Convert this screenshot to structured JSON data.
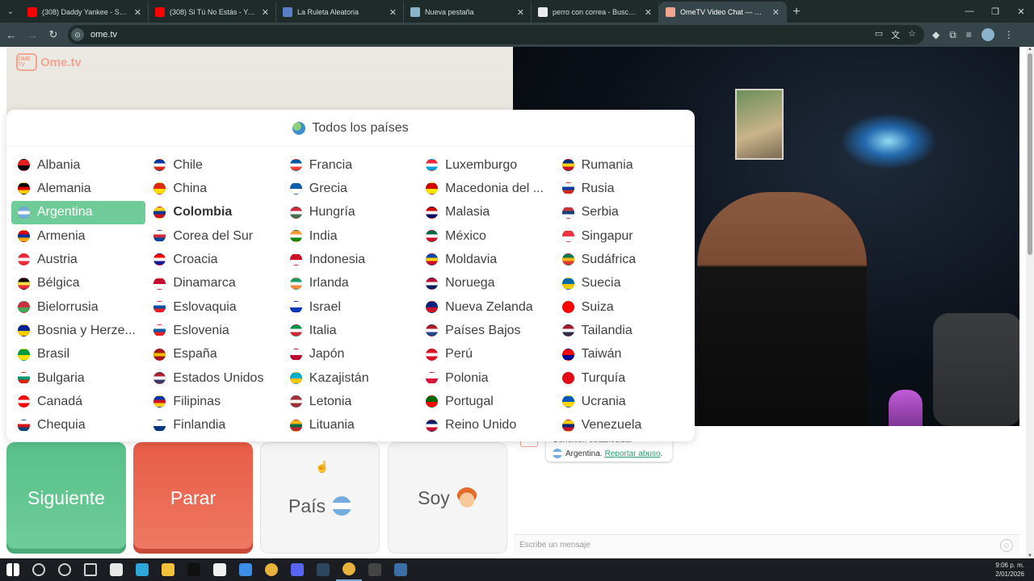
{
  "browser": {
    "tabs": [
      {
        "title": "(308) Daddy Yankee - Somos de Calle",
        "favicon_color": "#ff0000",
        "active": false
      },
      {
        "title": "(308) Si Tú No Estás - YouTube",
        "favicon_color": "#ff0000",
        "active": false
      },
      {
        "title": "La Ruleta Aleatoria",
        "favicon_color": "#5b7fc7",
        "active": false
      },
      {
        "title": "Nueva pestaña",
        "favicon_color": "#8ab4c9",
        "active": false
      },
      {
        "title": "perro con correa - Buscar con Google",
        "favicon_color": "#e8eaed",
        "active": false
      },
      {
        "title": "OmeTV Video Chat — Ome",
        "favicon_color": "#f0a58f",
        "active": true
      }
    ],
    "url": "ome.tv",
    "window_controls": [
      "—",
      "❐",
      "✕"
    ]
  },
  "site": {
    "logo_text": "Ome.tv",
    "logo_badge": "OME TV",
    "brand_color": "#f0a58f"
  },
  "country_panel": {
    "title": "Todos los países",
    "selected": "Argentina",
    "countries": [
      {
        "name": "Albania",
        "flag": [
          "#e41e20",
          "#000000"
        ]
      },
      {
        "name": "Alemania",
        "flag": [
          "#000000",
          "#dd0000",
          "#ffce00"
        ]
      },
      {
        "name": "Argentina",
        "flag": [
          "#74acdf",
          "#ffffff",
          "#74acdf"
        ]
      },
      {
        "name": "Armenia",
        "flag": [
          "#d90012",
          "#0033a0",
          "#f2a800"
        ]
      },
      {
        "name": "Austria",
        "flag": [
          "#ed2939",
          "#ffffff",
          "#ed2939"
        ]
      },
      {
        "name": "Bélgica",
        "flag": [
          "#000000",
          "#fae042",
          "#ed2939"
        ]
      },
      {
        "name": "Bielorrusia",
        "flag": [
          "#c8313e",
          "#4aa657"
        ]
      },
      {
        "name": "Bosnia y Herze...",
        "flag": [
          "#002395",
          "#fecb00"
        ]
      },
      {
        "name": "Brasil",
        "flag": [
          "#009c3b",
          "#ffdf00"
        ]
      },
      {
        "name": "Bulgaria",
        "flag": [
          "#ffffff",
          "#00966e",
          "#d62612"
        ]
      },
      {
        "name": "Canadá",
        "flag": [
          "#ff0000",
          "#ffffff",
          "#ff0000"
        ]
      },
      {
        "name": "Chequia",
        "flag": [
          "#ffffff",
          "#d7141a",
          "#11457e"
        ]
      },
      {
        "name": "Chile",
        "flag": [
          "#0039a6",
          "#ffffff",
          "#d52b1e"
        ]
      },
      {
        "name": "China",
        "flag": [
          "#de2910",
          "#ffde00"
        ]
      },
      {
        "name": "Colombia",
        "flag": [
          "#fcd116",
          "#003893",
          "#ce1126"
        ]
      },
      {
        "name": "Corea del Sur",
        "flag": [
          "#ffffff",
          "#cd2e3a",
          "#0047a0"
        ]
      },
      {
        "name": "Croacia",
        "flag": [
          "#ff0000",
          "#ffffff",
          "#171796"
        ]
      },
      {
        "name": "Dinamarca",
        "flag": [
          "#c60c30",
          "#ffffff"
        ]
      },
      {
        "name": "Eslovaquia",
        "flag": [
          "#ffffff",
          "#0b4ea2",
          "#ee1c25"
        ]
      },
      {
        "name": "Eslovenia",
        "flag": [
          "#ffffff",
          "#005da4",
          "#ed1c24"
        ]
      },
      {
        "name": "España",
        "flag": [
          "#aa151b",
          "#f1bf00",
          "#aa151b"
        ]
      },
      {
        "name": "Estados Unidos",
        "flag": [
          "#b22234",
          "#ffffff",
          "#3c3b6e"
        ]
      },
      {
        "name": "Filipinas",
        "flag": [
          "#0038a8",
          "#ce1126",
          "#fcd116"
        ]
      },
      {
        "name": "Finlandia",
        "flag": [
          "#ffffff",
          "#003580"
        ]
      },
      {
        "name": "Francia",
        "flag": [
          "#0055a4",
          "#ffffff",
          "#ef4135"
        ]
      },
      {
        "name": "Grecia",
        "flag": [
          "#0d5eaf",
          "#ffffff"
        ]
      },
      {
        "name": "Hungría",
        "flag": [
          "#cd2a3e",
          "#ffffff",
          "#436f4d"
        ]
      },
      {
        "name": "India",
        "flag": [
          "#ff9933",
          "#ffffff",
          "#138808"
        ]
      },
      {
        "name": "Indonesia",
        "flag": [
          "#ce1126",
          "#ffffff"
        ]
      },
      {
        "name": "Irlanda",
        "flag": [
          "#169b62",
          "#ffffff",
          "#ff883e"
        ]
      },
      {
        "name": "Israel",
        "flag": [
          "#ffffff",
          "#0038b8"
        ]
      },
      {
        "name": "Italia",
        "flag": [
          "#009246",
          "#ffffff",
          "#ce2b37"
        ]
      },
      {
        "name": "Japón",
        "flag": [
          "#ffffff",
          "#bc002d"
        ]
      },
      {
        "name": "Kazajistán",
        "flag": [
          "#00afca",
          "#fec50c"
        ]
      },
      {
        "name": "Letonia",
        "flag": [
          "#9e3039",
          "#ffffff",
          "#9e3039"
        ]
      },
      {
        "name": "Lituania",
        "flag": [
          "#fdb913",
          "#006a44",
          "#c1272d"
        ]
      },
      {
        "name": "Luxemburgo",
        "flag": [
          "#ed2939",
          "#ffffff",
          "#00a1de"
        ]
      },
      {
        "name": "Macedonia del ...",
        "flag": [
          "#d20000",
          "#ffe600"
        ]
      },
      {
        "name": "Malasia",
        "flag": [
          "#cc0001",
          "#ffffff",
          "#010066"
        ]
      },
      {
        "name": "México",
        "flag": [
          "#006847",
          "#ffffff",
          "#ce1126"
        ]
      },
      {
        "name": "Moldavia",
        "flag": [
          "#0046ae",
          "#ffd200",
          "#cc092f"
        ]
      },
      {
        "name": "Noruega",
        "flag": [
          "#ba0c2f",
          "#ffffff",
          "#00205b"
        ]
      },
      {
        "name": "Nueva Zelanda",
        "flag": [
          "#00247d",
          "#cc142b"
        ]
      },
      {
        "name": "Países Bajos",
        "flag": [
          "#ae1c28",
          "#ffffff",
          "#21468b"
        ]
      },
      {
        "name": "Perú",
        "flag": [
          "#d91023",
          "#ffffff",
          "#d91023"
        ]
      },
      {
        "name": "Polonia",
        "flag": [
          "#ffffff",
          "#dc143c"
        ]
      },
      {
        "name": "Portugal",
        "flag": [
          "#006600",
          "#ff0000"
        ]
      },
      {
        "name": "Reino Unido",
        "flag": [
          "#012169",
          "#ffffff",
          "#c8102e"
        ]
      },
      {
        "name": "Rumania",
        "flag": [
          "#002b7f",
          "#fcd116",
          "#ce1126"
        ]
      },
      {
        "name": "Rusia",
        "flag": [
          "#ffffff",
          "#0039a6",
          "#d52b1e"
        ]
      },
      {
        "name": "Serbia",
        "flag": [
          "#c6363c",
          "#0c4076",
          "#ffffff"
        ]
      },
      {
        "name": "Singapur",
        "flag": [
          "#ef3340",
          "#ffffff"
        ]
      },
      {
        "name": "Sudáfrica",
        "flag": [
          "#007a4d",
          "#ffb612",
          "#de3831"
        ]
      },
      {
        "name": "Suecia",
        "flag": [
          "#006aa7",
          "#fecc00"
        ]
      },
      {
        "name": "Suiza",
        "flag": [
          "#ff0000",
          "#ff0000"
        ]
      },
      {
        "name": "Tailandia",
        "flag": [
          "#a51931",
          "#ffffff",
          "#2d2a4a"
        ]
      },
      {
        "name": "Taiwán",
        "flag": [
          "#fe0000",
          "#000095"
        ]
      },
      {
        "name": "Turquía",
        "flag": [
          "#e30a17",
          "#e30a17"
        ]
      },
      {
        "name": "Ucrania",
        "flag": [
          "#0057b7",
          "#ffd700"
        ]
      },
      {
        "name": "Venezuela",
        "flag": [
          "#ffcc00",
          "#00247d",
          "#cf142b"
        ]
      }
    ]
  },
  "controls": {
    "next_label": "Siguiente",
    "stop_label": "Parar",
    "country_label": "País",
    "gender_label": "Soy",
    "next_color": "#6fcc98",
    "stop_color": "#ef7a64"
  },
  "chat": {
    "status_line": "Conexión establecida.",
    "partner_country": "Argentina.",
    "report_link": "Reportar abuso",
    "report_suffix": ".",
    "input_placeholder": "Escribe un mensaje"
  },
  "taskbar": {
    "time": "9:06 p. m.",
    "date": "2/01/2026",
    "icons": [
      {
        "name": "windows-start-icon",
        "color": "#ffffff",
        "active": false
      },
      {
        "name": "search-icon",
        "color": "#d0d0d0",
        "active": false
      },
      {
        "name": "cortana-icon",
        "color": "#d0d0d0",
        "active": false
      },
      {
        "name": "task-view-icon",
        "color": "#d0d0d0",
        "active": false
      },
      {
        "name": "file-icon",
        "color": "#e8e8e8",
        "active": false
      },
      {
        "name": "edge-icon",
        "color": "#2ea7d8",
        "active": false
      },
      {
        "name": "file-explorer-icon",
        "color": "#f3c13a",
        "active": false
      },
      {
        "name": "tiktok-icon",
        "color": "#111111",
        "active": false
      },
      {
        "name": "store-icon",
        "color": "#f0f0f0",
        "active": false
      },
      {
        "name": "mail-icon",
        "color": "#3a8ee6",
        "active": false
      },
      {
        "name": "chrome-icon",
        "color": "#e8b33a",
        "active": false
      },
      {
        "name": "discord-icon",
        "color": "#5865f2",
        "active": false
      },
      {
        "name": "steam-icon",
        "color": "#2a475e",
        "active": false
      },
      {
        "name": "chrome-active-icon",
        "color": "#e8b33a",
        "active": true
      },
      {
        "name": "obs-icon",
        "color": "#444444",
        "active": false
      },
      {
        "name": "calculator-icon",
        "color": "#3a6ea5",
        "active": false
      }
    ]
  }
}
